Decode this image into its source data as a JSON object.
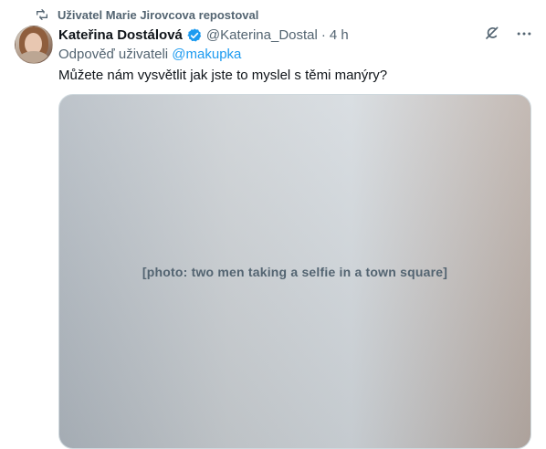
{
  "repost": {
    "text": "Uživatel Marie Jirovcova repostoval"
  },
  "author": {
    "name": "Kateřina Dostálová",
    "handle": "@Katerina_Dostal",
    "separator": "·",
    "time": "4 h"
  },
  "reply": {
    "prefix": "Odpověď uživateli ",
    "mention": "@makupka"
  },
  "tweet": {
    "text": "Můžete nám vysvětlit jak jste to myslel s těmi manýry?"
  },
  "icons": {
    "repost": "repost-icon",
    "verified": "verified-badge-icon",
    "grok": "grok-icon",
    "more": "more-icon",
    "avatar": "avatar-icon"
  },
  "colors": {
    "text": "#0f1419",
    "muted": "#536471",
    "accent": "#1d9bf0",
    "border": "#cfd9de",
    "verified": "#1d9bf0"
  },
  "media": {
    "label": "[photo: two men taking a selfie in a town square]"
  }
}
